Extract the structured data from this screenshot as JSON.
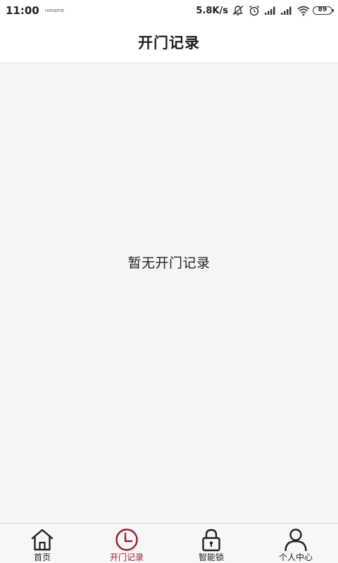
{
  "status_bar": {
    "time": "11:00",
    "notification_text": "noname",
    "net_speed": "5.8K/s",
    "battery": "89"
  },
  "header": {
    "title": "开门记录"
  },
  "main": {
    "empty_message": "暂无开门记录"
  },
  "tab_bar": {
    "accent_color": "#a01c2a",
    "tabs": [
      {
        "label": "首页",
        "icon": "home-icon",
        "active": false
      },
      {
        "label": "开门记录",
        "icon": "clock-icon",
        "active": true
      },
      {
        "label": "智能锁",
        "icon": "lock-icon",
        "active": false
      },
      {
        "label": "个人中心",
        "icon": "person-icon",
        "active": false
      }
    ]
  }
}
